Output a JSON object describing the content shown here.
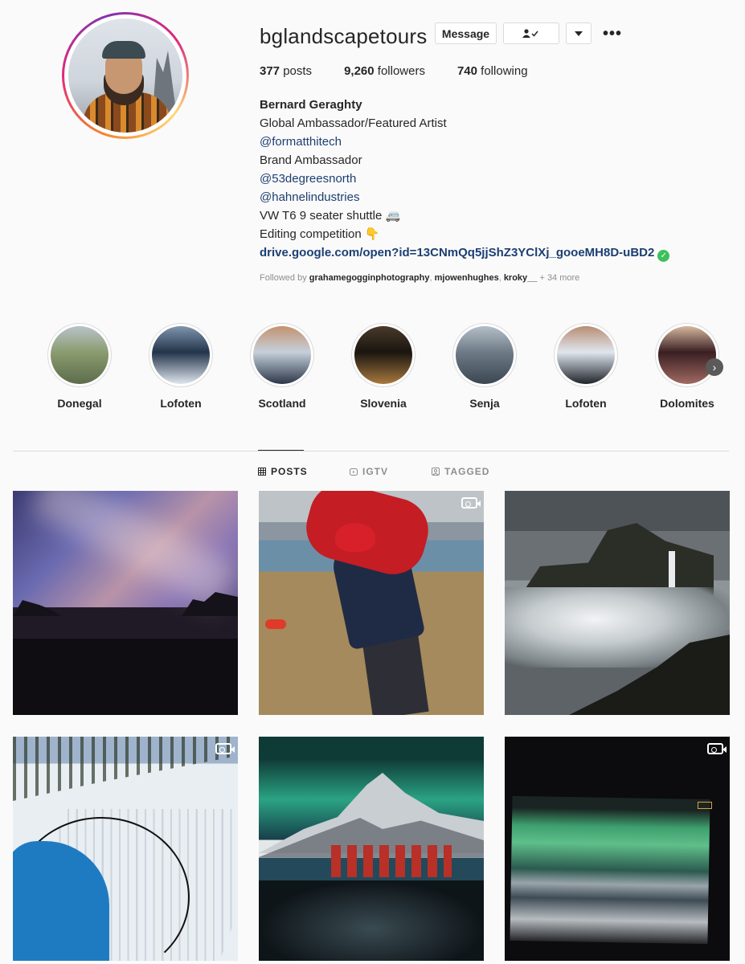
{
  "profile": {
    "username": "bglandscapetours",
    "message_label": "Message",
    "following_icon": "person-check-icon",
    "dropdown_icon": "chevron-down-icon",
    "more_icon": "more-dots-icon",
    "more_glyph": "•••"
  },
  "stats": {
    "posts_count": "377",
    "posts_label": "posts",
    "followers_count": "9,260",
    "followers_label": "followers",
    "following_count": "740",
    "following_label": "following"
  },
  "bio": {
    "name": "Bernard Geraghty",
    "line1": "Global Ambassador/Featured Artist",
    "mention1": "@formatthitech",
    "line2": "Brand Ambassador",
    "mention2": "@53degreesnorth",
    "mention3": "@hahnelindustries",
    "line3": "VW T6 9 seater shuttle 🚐",
    "line4": "Editing competition 👇",
    "website": "drive.google.com/open?id=13CNmQq5jjShZ3YClXj_gooeMH8D-uBD2",
    "verified_glyph": "✓"
  },
  "followed_by": {
    "prefix": "Followed by ",
    "users": [
      "grahamegogginphotography",
      "mjowenhughes",
      "kroky__"
    ],
    "separator": ", ",
    "more": " + 34 more"
  },
  "highlights": [
    {
      "label": "Donegal",
      "colors": [
        "#8a9c6f",
        "#5d6b4c",
        "#b9c3c9"
      ]
    },
    {
      "label": "Lofoten",
      "colors": [
        "#23344a",
        "#dfe6ee",
        "#7f96ad"
      ]
    },
    {
      "label": "Scotland",
      "colors": [
        "#c5d0db",
        "#2c3648",
        "#c49270"
      ]
    },
    {
      "label": "Slovenia",
      "colors": [
        "#1a1510",
        "#a7793e",
        "#4a3a2a"
      ]
    },
    {
      "label": "Senja",
      "colors": [
        "#6e7b86",
        "#3a4652",
        "#b3bec8"
      ]
    },
    {
      "label": "Lofoten",
      "colors": [
        "#dfe6ee",
        "#1f232a",
        "#b88d73"
      ]
    },
    {
      "label": "Dolomites",
      "colors": [
        "#3a1f22",
        "#a06a62",
        "#d7b8a0"
      ]
    }
  ],
  "highlights_next_icon": "chevron-right-icon",
  "highlights_next_glyph": "›",
  "tabs": [
    {
      "label": "POSTS",
      "icon": "grid-icon",
      "active": true
    },
    {
      "label": "IGTV",
      "icon": "igtv-icon",
      "active": false
    },
    {
      "label": "TAGGED",
      "icon": "tagged-icon",
      "active": false
    }
  ],
  "posts": [
    {
      "type": "photo",
      "subject": "milky-way-coast"
    },
    {
      "type": "video",
      "subject": "man-with-jacket"
    },
    {
      "type": "photo",
      "subject": "waterfall-cliffs"
    },
    {
      "type": "video",
      "subject": "ski-track"
    },
    {
      "type": "photo",
      "subject": "aurora-lofoten-village"
    },
    {
      "type": "video",
      "subject": "aurora-screen"
    }
  ],
  "colors": {
    "link": "#1c3f72",
    "verified": "#3cc15b",
    "muted": "#8e8e8e",
    "text": "#262626"
  }
}
